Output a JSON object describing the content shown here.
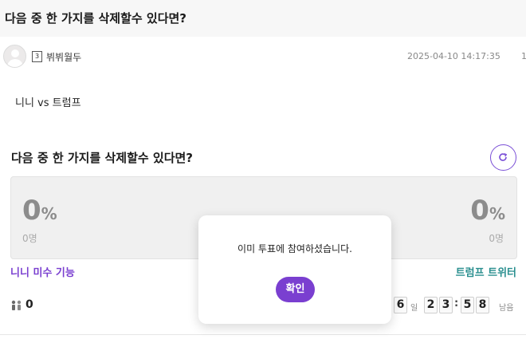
{
  "post": {
    "title": "다음 중 한 가지를 삭제할수 있다면?",
    "author": {
      "level": "3",
      "name": "뷔뷔월두"
    },
    "date": "2025-04-10 14:17:35",
    "views": "1",
    "body": "니니 vs 트럼프"
  },
  "poll": {
    "title": "다음 중 한 가지를 삭제할수 있다면?",
    "options": [
      {
        "label": "니니 미수 기능",
        "percent": "0",
        "votes": "0명",
        "color": "#7a3fd0"
      },
      {
        "label": "트럼프 트위터",
        "percent": "0",
        "votes": "0명",
        "color": "#2a8f8f"
      }
    ],
    "percent_sign": "%",
    "participants": "0",
    "timer": {
      "days": [
        "6"
      ],
      "day_label": "일",
      "hours": [
        "2",
        "3"
      ],
      "minutes": [
        "5",
        "8"
      ],
      "separator": ":",
      "remaining_label": "남음"
    }
  },
  "modal": {
    "message": "이미 투표에 참여하셨습니다.",
    "confirm_label": "확인"
  },
  "colors": {
    "accent": "#7a3fd0",
    "option_right": "#2a8f8f",
    "poll_box_bg": "#f0f0f0"
  },
  "icons": {
    "refresh": "refresh-icon",
    "participants": "people-icon",
    "avatar": "user-avatar-icon"
  }
}
